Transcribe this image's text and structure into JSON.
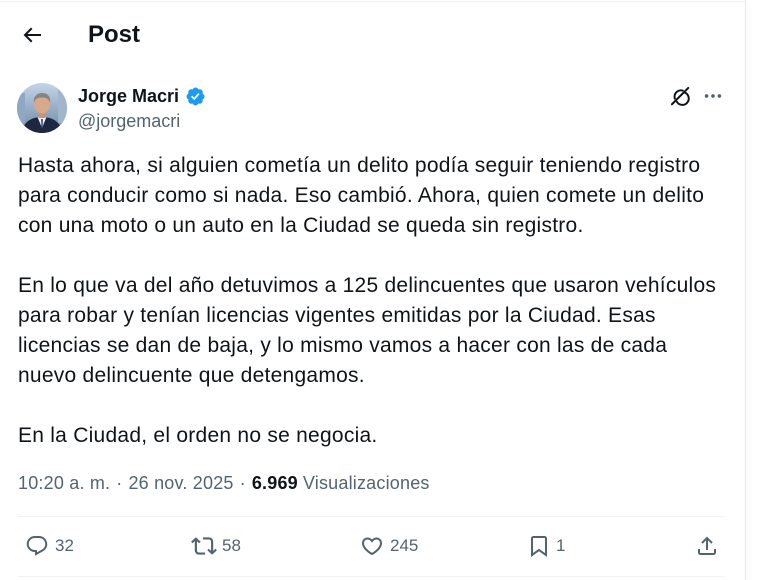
{
  "header": {
    "title": "Post"
  },
  "post": {
    "author": {
      "name": "Jorge Macri",
      "handle": "@jorgemacri",
      "verified": true
    },
    "text": {
      "paragraphs": [
        {
          "lines": [
            "Hasta ahora, si alguien cometía un delito podía seguir teniendo registro",
            "para conducir como si nada. Eso cambió. Ahora, quien comete un delito",
            "con una moto o un auto en la Ciudad se queda sin registro."
          ]
        },
        {
          "lines": [
            "En lo que va del año detuvimos a 125 delincuentes que usaron vehículos",
            "para robar y tenían licencias vigentes emitidas por la Ciudad. Esas",
            "licencias se dan de baja, y lo mismo vamos a hacer con las de cada",
            "nuevo delincuente que detengamos."
          ]
        },
        {
          "lines": [
            "En la Ciudad, el orden no se negocia."
          ]
        }
      ]
    },
    "meta": {
      "time": "10:20 a. m.",
      "separator": "·",
      "date": "26 nov. 2025",
      "views_count": "6.969",
      "views_label": "Visualizaciones"
    },
    "actions": {
      "replies": "32",
      "reposts": "58",
      "likes": "245",
      "bookmarks": "1"
    }
  },
  "icons": {
    "back": "arrow-left-icon",
    "verified": "verified-badge-icon",
    "grok": "grok-icon",
    "more": "more-icon",
    "reply": "reply-icon",
    "repost": "repost-icon",
    "like": "heart-icon",
    "bookmark": "bookmark-icon",
    "share": "share-icon"
  },
  "colors": {
    "text": "#0f1419",
    "secondary": "#536471",
    "verified": "#1d9bf0",
    "border": "#eff3f4",
    "background": "#ffffff"
  }
}
